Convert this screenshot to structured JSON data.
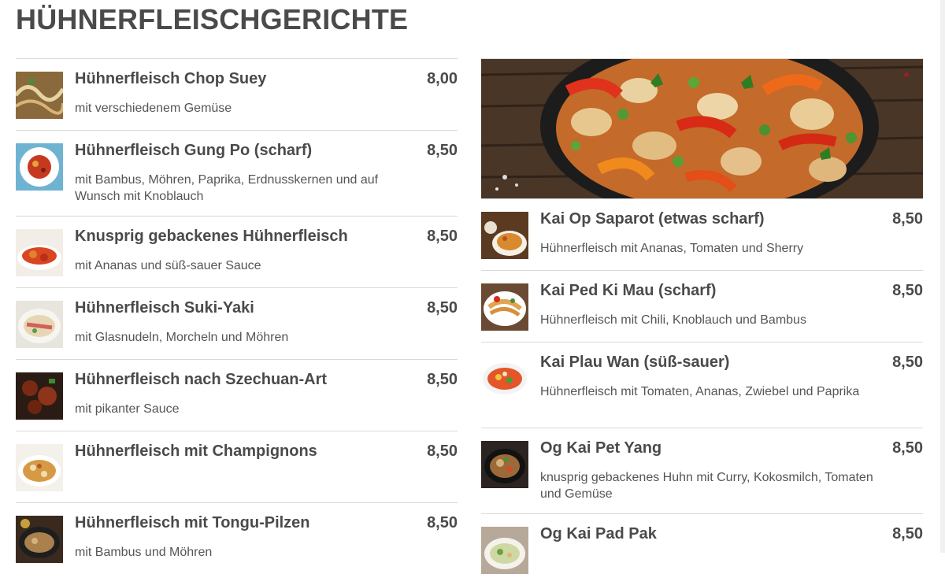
{
  "page_title": "HÜHNERFLEISCHGERICHTE",
  "left_items": [
    {
      "name": "Hühnerfleisch Chop Suey",
      "price": "8,00",
      "desc": "mit verschiedenem Gemüse"
    },
    {
      "name": "Hühnerfleisch Gung Po (scharf)",
      "price": "8,50",
      "desc": "mit Bambus, Möhren, Paprika, Erdnusskernen und auf Wunsch mit Knoblauch"
    },
    {
      "name": "Knusprig gebackenes Hühnerfleisch",
      "price": "8,50",
      "desc": "mit Ananas und süß-sauer Sauce"
    },
    {
      "name": "Hühnerfleisch Suki-Yaki",
      "price": "8,50",
      "desc": "mit Glasnudeln, Morcheln und Möhren"
    },
    {
      "name": "Hühnerfleisch nach Szechuan-Art",
      "price": "8,50",
      "desc": "mit pikanter Sauce"
    },
    {
      "name": "Hühnerfleisch mit Champignons",
      "price": "8,50",
      "desc": ""
    },
    {
      "name": "Hühnerfleisch mit Tongu-Pilzen",
      "price": "8,50",
      "desc": "mit Bambus und Möhren"
    }
  ],
  "right_items": [
    {
      "name": "Kai Op Saparot (etwas scharf)",
      "price": "8,50",
      "desc": "Hühnerfleisch mit Ananas, Tomaten und Sherry"
    },
    {
      "name": "Kai Ped Ki Mau (scharf)",
      "price": "8,50",
      "desc": "Hühnerfleisch mit Chili, Knoblauch und Bambus"
    },
    {
      "name": "Kai Plau Wan (süß-sauer)",
      "price": "8,50",
      "desc": "Hühnerfleisch mit Tomaten, Ananas, Zwiebel und Paprika"
    },
    {
      "name": "Og Kai Pet Yang",
      "price": "8,50",
      "desc": "knusprig gebackenes Huhn mit Curry, Kokosmilch, Tomaten und Gemüse"
    },
    {
      "name": "Og Kai Pad Pak",
      "price": "8,50",
      "desc": ""
    }
  ],
  "colors": {
    "text": "#4a4a4a",
    "divider": "#d9d9d9",
    "background": "#ffffff"
  }
}
